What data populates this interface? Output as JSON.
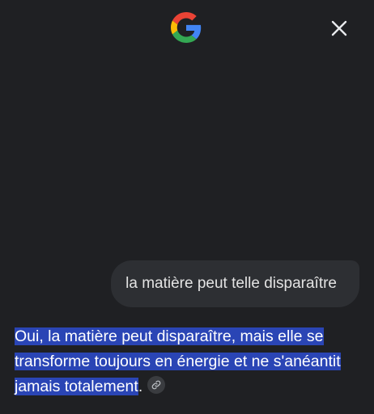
{
  "header": {
    "logo_icon": "google-g-icon",
    "close_icon": "close-icon"
  },
  "conversation": {
    "user_message": "la matière peut telle disparaître",
    "response_text": "Oui, la matière peut disparaître, mais elle se transforme toujours en énergie et ne s'anéantit jamais totalement",
    "response_end": ".",
    "source_icon": "link-icon"
  },
  "colors": {
    "background": "#1f2023",
    "bubble": "#2d2f33",
    "highlight": "#2a45b5",
    "google_blue": "#4285F4",
    "google_red": "#EA4335",
    "google_yellow": "#FBBC05",
    "google_green": "#34A853"
  }
}
